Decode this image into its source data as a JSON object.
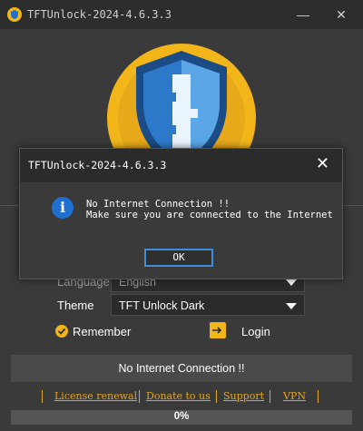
{
  "window": {
    "title": "TFTUnlock-2024-4.6.3.3",
    "minimize": "—",
    "close": "✕"
  },
  "form": {
    "language_label": "Language",
    "language_value": "English",
    "theme_label": "Theme",
    "theme_value": "TFT Unlock Dark",
    "remember_label": "Remember",
    "login_label": "Login"
  },
  "status": {
    "text": "No Internet Connection !!"
  },
  "links": [
    "License renewal",
    "Donate to us",
    "Support",
    "VPN"
  ],
  "progress": {
    "value": 0,
    "label": "0%"
  },
  "dialog": {
    "title": "TFTUnlock-2024-4.6.3.3",
    "close": "✕",
    "message_line1": "No Internet Connection !!",
    "message_line2": "Make sure you are connected to the Internet",
    "ok_label": "OK",
    "icon": "info-icon"
  },
  "colors": {
    "accent": "#f2b51a",
    "link": "#e0a522",
    "dialog_focus": "#3f8ed8",
    "info_blue": "#1e6fd0"
  }
}
